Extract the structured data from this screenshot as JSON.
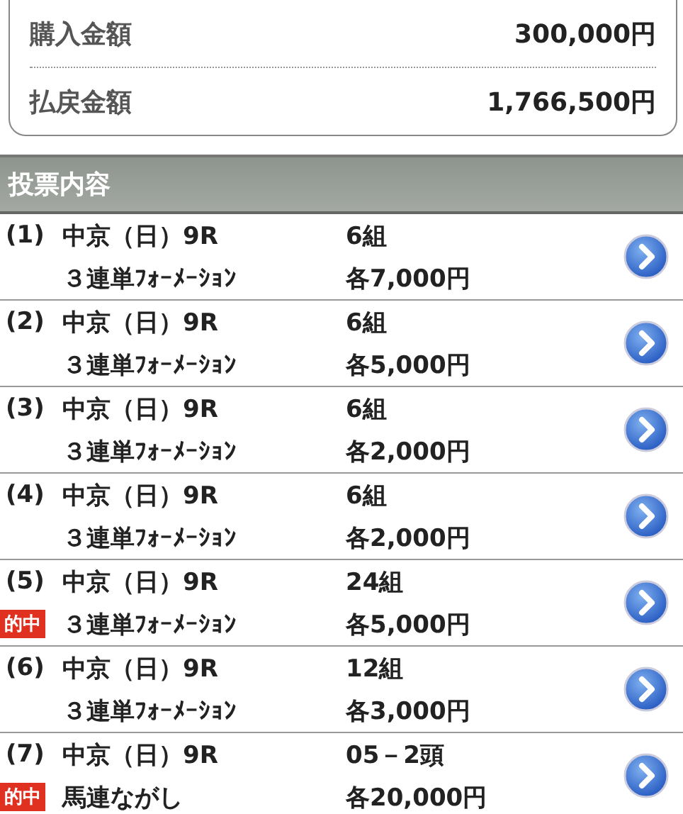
{
  "summary": [
    {
      "label": "購入金額",
      "value": "300,000円"
    },
    {
      "label": "払戻金額",
      "value": "1,766,500円"
    }
  ],
  "section_title": "投票内容",
  "bets": [
    {
      "number": "(1)",
      "race": "中京（日）9R",
      "type": "３連単ﾌｫｰﾒｰｼｮﾝ",
      "count": "6組",
      "amount": "各7,000円",
      "hit": false
    },
    {
      "number": "(2)",
      "race": "中京（日）9R",
      "type": "３連単ﾌｫｰﾒｰｼｮﾝ",
      "count": "6組",
      "amount": "各5,000円",
      "hit": false
    },
    {
      "number": "(3)",
      "race": "中京（日）9R",
      "type": "３連単ﾌｫｰﾒｰｼｮﾝ",
      "count": "6組",
      "amount": "各2,000円",
      "hit": false
    },
    {
      "number": "(4)",
      "race": "中京（日）9R",
      "type": "３連単ﾌｫｰﾒｰｼｮﾝ",
      "count": "6組",
      "amount": "各2,000円",
      "hit": false
    },
    {
      "number": "(5)",
      "race": "中京（日）9R",
      "type": "３連単ﾌｫｰﾒｰｼｮﾝ",
      "count": "24組",
      "amount": "各5,000円",
      "hit": true,
      "hit_label": "的中"
    },
    {
      "number": "(6)",
      "race": "中京（日）9R",
      "type": "３連単ﾌｫｰﾒｰｼｮﾝ",
      "count": "12組",
      "amount": "各3,000円",
      "hit": false
    },
    {
      "number": "(7)",
      "race": "中京（日）9R",
      "type": "馬連ながし",
      "count": "05－2頭",
      "amount": "各20,000円",
      "hit": true,
      "hit_label": "的中"
    }
  ]
}
